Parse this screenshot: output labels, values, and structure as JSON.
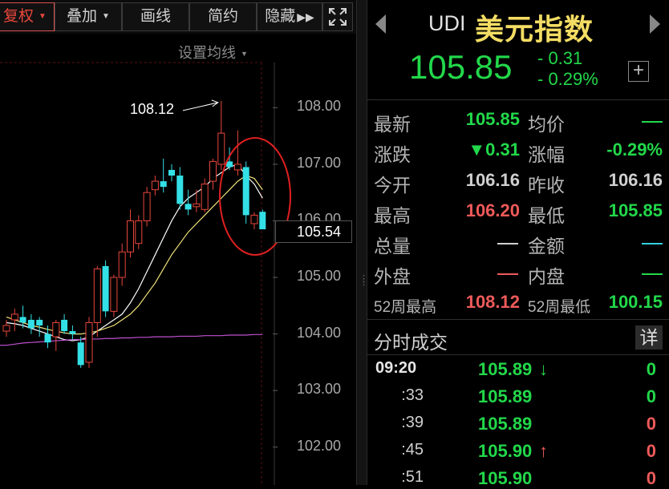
{
  "toolbar": {
    "buttons": [
      {
        "label": "复权",
        "dropdown": true,
        "active": true
      },
      {
        "label": "叠加",
        "dropdown": true,
        "active": false
      },
      {
        "label": "画线",
        "dropdown": false,
        "active": false
      },
      {
        "label": "简约",
        "dropdown": false,
        "active": false
      },
      {
        "label": "隐藏",
        "dropdown": false,
        "active": false
      }
    ],
    "expand_icon": "expand-icon"
  },
  "chart": {
    "ma_setting_label": "设置均线",
    "y_axis_labels": [
      "108.00",
      "107.00",
      "106.00",
      "105.00",
      "104.00",
      "103.00",
      "102.00"
    ],
    "current_price_tag": "105.54",
    "peak_annotation": "108.12",
    "colors": {
      "up": "#e8463c",
      "down": "#33e0e6",
      "ma5": "#ffffff",
      "ma10": "#f0e37a",
      "ma60": "#c050d0",
      "annotation_circle": "#e02020",
      "grid": "#5a1010"
    }
  },
  "chart_data": {
    "type": "candlestick",
    "ylim": [
      101.5,
      108.6
    ],
    "candles": [
      {
        "o": 104.05,
        "h": 104.25,
        "l": 103.95,
        "c": 104.15
      },
      {
        "o": 104.25,
        "h": 104.45,
        "l": 104.05,
        "c": 104.35
      },
      {
        "o": 104.3,
        "h": 104.5,
        "l": 104.1,
        "c": 104.2
      },
      {
        "o": 104.25,
        "h": 104.35,
        "l": 104.0,
        "c": 104.1
      },
      {
        "o": 104.25,
        "h": 104.3,
        "l": 103.95,
        "c": 104.15
      },
      {
        "o": 104.0,
        "h": 104.15,
        "l": 103.75,
        "c": 103.85
      },
      {
        "o": 103.95,
        "h": 104.25,
        "l": 103.7,
        "c": 104.2
      },
      {
        "o": 104.25,
        "h": 104.35,
        "l": 104.0,
        "c": 104.05
      },
      {
        "o": 104.05,
        "h": 104.15,
        "l": 103.9,
        "c": 104.0
      },
      {
        "o": 103.85,
        "h": 103.95,
        "l": 103.4,
        "c": 103.45
      },
      {
        "o": 103.5,
        "h": 104.3,
        "l": 103.4,
        "c": 104.2
      },
      {
        "o": 104.2,
        "h": 105.2,
        "l": 103.95,
        "c": 105.15
      },
      {
        "o": 105.2,
        "h": 105.3,
        "l": 104.3,
        "c": 104.4
      },
      {
        "o": 104.4,
        "h": 105.05,
        "l": 104.3,
        "c": 105.0
      },
      {
        "o": 105.0,
        "h": 105.6,
        "l": 104.85,
        "c": 105.45
      },
      {
        "o": 105.45,
        "h": 106.2,
        "l": 105.35,
        "c": 106.0
      },
      {
        "o": 105.6,
        "h": 106.1,
        "l": 105.5,
        "c": 106.0
      },
      {
        "o": 106.0,
        "h": 106.6,
        "l": 105.9,
        "c": 106.5
      },
      {
        "o": 106.55,
        "h": 106.8,
        "l": 106.45,
        "c": 106.7
      },
      {
        "o": 106.7,
        "h": 107.1,
        "l": 106.5,
        "c": 106.6
      },
      {
        "o": 106.9,
        "h": 107.0,
        "l": 106.7,
        "c": 106.8
      },
      {
        "o": 106.8,
        "h": 106.95,
        "l": 106.2,
        "c": 106.3
      },
      {
        "o": 106.3,
        "h": 106.55,
        "l": 106.1,
        "c": 106.2
      },
      {
        "o": 106.25,
        "h": 106.55,
        "l": 106.15,
        "c": 106.3
      },
      {
        "o": 106.2,
        "h": 106.75,
        "l": 106.15,
        "c": 106.65
      },
      {
        "o": 106.7,
        "h": 107.1,
        "l": 106.55,
        "c": 107.05
      },
      {
        "o": 107.0,
        "h": 108.12,
        "l": 106.9,
        "c": 107.55
      },
      {
        "o": 107.05,
        "h": 107.3,
        "l": 106.9,
        "c": 106.95
      },
      {
        "o": 106.9,
        "h": 107.6,
        "l": 106.8,
        "c": 107.0
      },
      {
        "o": 106.95,
        "h": 107.05,
        "l": 105.95,
        "c": 106.1
      },
      {
        "o": 105.95,
        "h": 106.15,
        "l": 105.85,
        "c": 106.1
      },
      {
        "o": 106.16,
        "h": 106.2,
        "l": 105.85,
        "c": 105.85
      }
    ],
    "ma_lines": [
      {
        "name": "MA5",
        "values": [
          104.2,
          104.18,
          104.15,
          104.1,
          104.05,
          104.0,
          103.95,
          103.9,
          103.88,
          103.9,
          103.95,
          104.05,
          104.15,
          104.25,
          104.35,
          104.55,
          104.8,
          105.1,
          105.4,
          105.7,
          106.0,
          106.25,
          106.4,
          106.5,
          106.6,
          106.75,
          106.85,
          106.95,
          107.0,
          106.8,
          106.65,
          106.4
        ]
      },
      {
        "name": "MA10",
        "values": [
          104.3,
          104.25,
          104.2,
          104.15,
          104.12,
          104.08,
          104.05,
          104.02,
          104.0,
          104.0,
          104.02,
          104.05,
          104.1,
          104.15,
          104.25,
          104.35,
          104.5,
          104.7,
          104.9,
          105.15,
          105.4,
          105.6,
          105.8,
          105.95,
          106.1,
          106.25,
          106.4,
          106.55,
          106.7,
          106.8,
          106.75,
          106.55
        ]
      },
      {
        "name": "MA60",
        "values": [
          103.8,
          103.82,
          103.84,
          103.85,
          103.86,
          103.87,
          103.88,
          103.89,
          103.9,
          103.9,
          103.91,
          103.91,
          103.92,
          103.92,
          103.93,
          103.93,
          103.94,
          103.94,
          103.95,
          103.95,
          103.95,
          103.96,
          103.96,
          103.96,
          103.97,
          103.97,
          103.97,
          103.98,
          103.98,
          103.98,
          103.99,
          103.99
        ]
      }
    ]
  },
  "quote": {
    "code": "UDI",
    "name": "美元指数",
    "price": "105.85",
    "change": "- 0.31",
    "change_pct": "- 0.29%",
    "rows": [
      {
        "l1": "最新",
        "v1": "105.85",
        "c1": "#22d84a",
        "l2": "均价",
        "v2": "—",
        "c2": "#22d84a",
        "dash2": true
      },
      {
        "l1": "涨跌",
        "v1": "▼0.31",
        "c1": "#22d84a",
        "l2": "涨幅",
        "v2": "-0.29%",
        "c2": "#22d84a"
      },
      {
        "l1": "今开",
        "v1": "106.16",
        "c1": "#d0d0d0",
        "l2": "昨收",
        "v2": "106.16",
        "c2": "#d0d0d0"
      },
      {
        "l1": "最高",
        "v1": "106.20",
        "c1": "#ef5a5a",
        "l2": "最低",
        "v2": "105.85",
        "c2": "#22d84a"
      },
      {
        "l1": "总量",
        "v1": "—",
        "c1": "#d0d0d0",
        "dash1": true,
        "l2": "金额",
        "v2": "—",
        "c2": "#33d0e0",
        "dash2": true
      },
      {
        "l1": "外盘",
        "v1": "—",
        "c1": "#ef5a5a",
        "dash1": true,
        "l2": "内盘",
        "v2": "—",
        "c2": "#22d84a",
        "dash2": true
      },
      {
        "l1": "52周最高",
        "v1": "108.12",
        "c1": "#ef5a5a",
        "l2": "52周最低",
        "v2": "100.15",
        "c2": "#22d84a",
        "small": true
      }
    ]
  },
  "ticks": {
    "title": "分时成交",
    "detail_label": "详",
    "rows": [
      {
        "time": "09:20",
        "price": "105.89",
        "arrow": "↓",
        "arrow_color": "#22d84a",
        "vol": "0",
        "vol_color": "#22d84a"
      },
      {
        "time": ":33",
        "price": "105.89",
        "arrow": "",
        "arrow_color": "",
        "vol": "0",
        "vol_color": "#22d84a"
      },
      {
        "time": ":39",
        "price": "105.89",
        "arrow": "",
        "arrow_color": "",
        "vol": "0",
        "vol_color": "#ef5a5a"
      },
      {
        "time": ":45",
        "price": "105.90",
        "arrow": "↑",
        "arrow_color": "#ef5a5a",
        "vol": "0",
        "vol_color": "#ef5a5a"
      },
      {
        "time": ":51",
        "price": "105.90",
        "arrow": "",
        "arrow_color": "",
        "vol": "0",
        "vol_color": "#ef5a5a"
      }
    ]
  }
}
